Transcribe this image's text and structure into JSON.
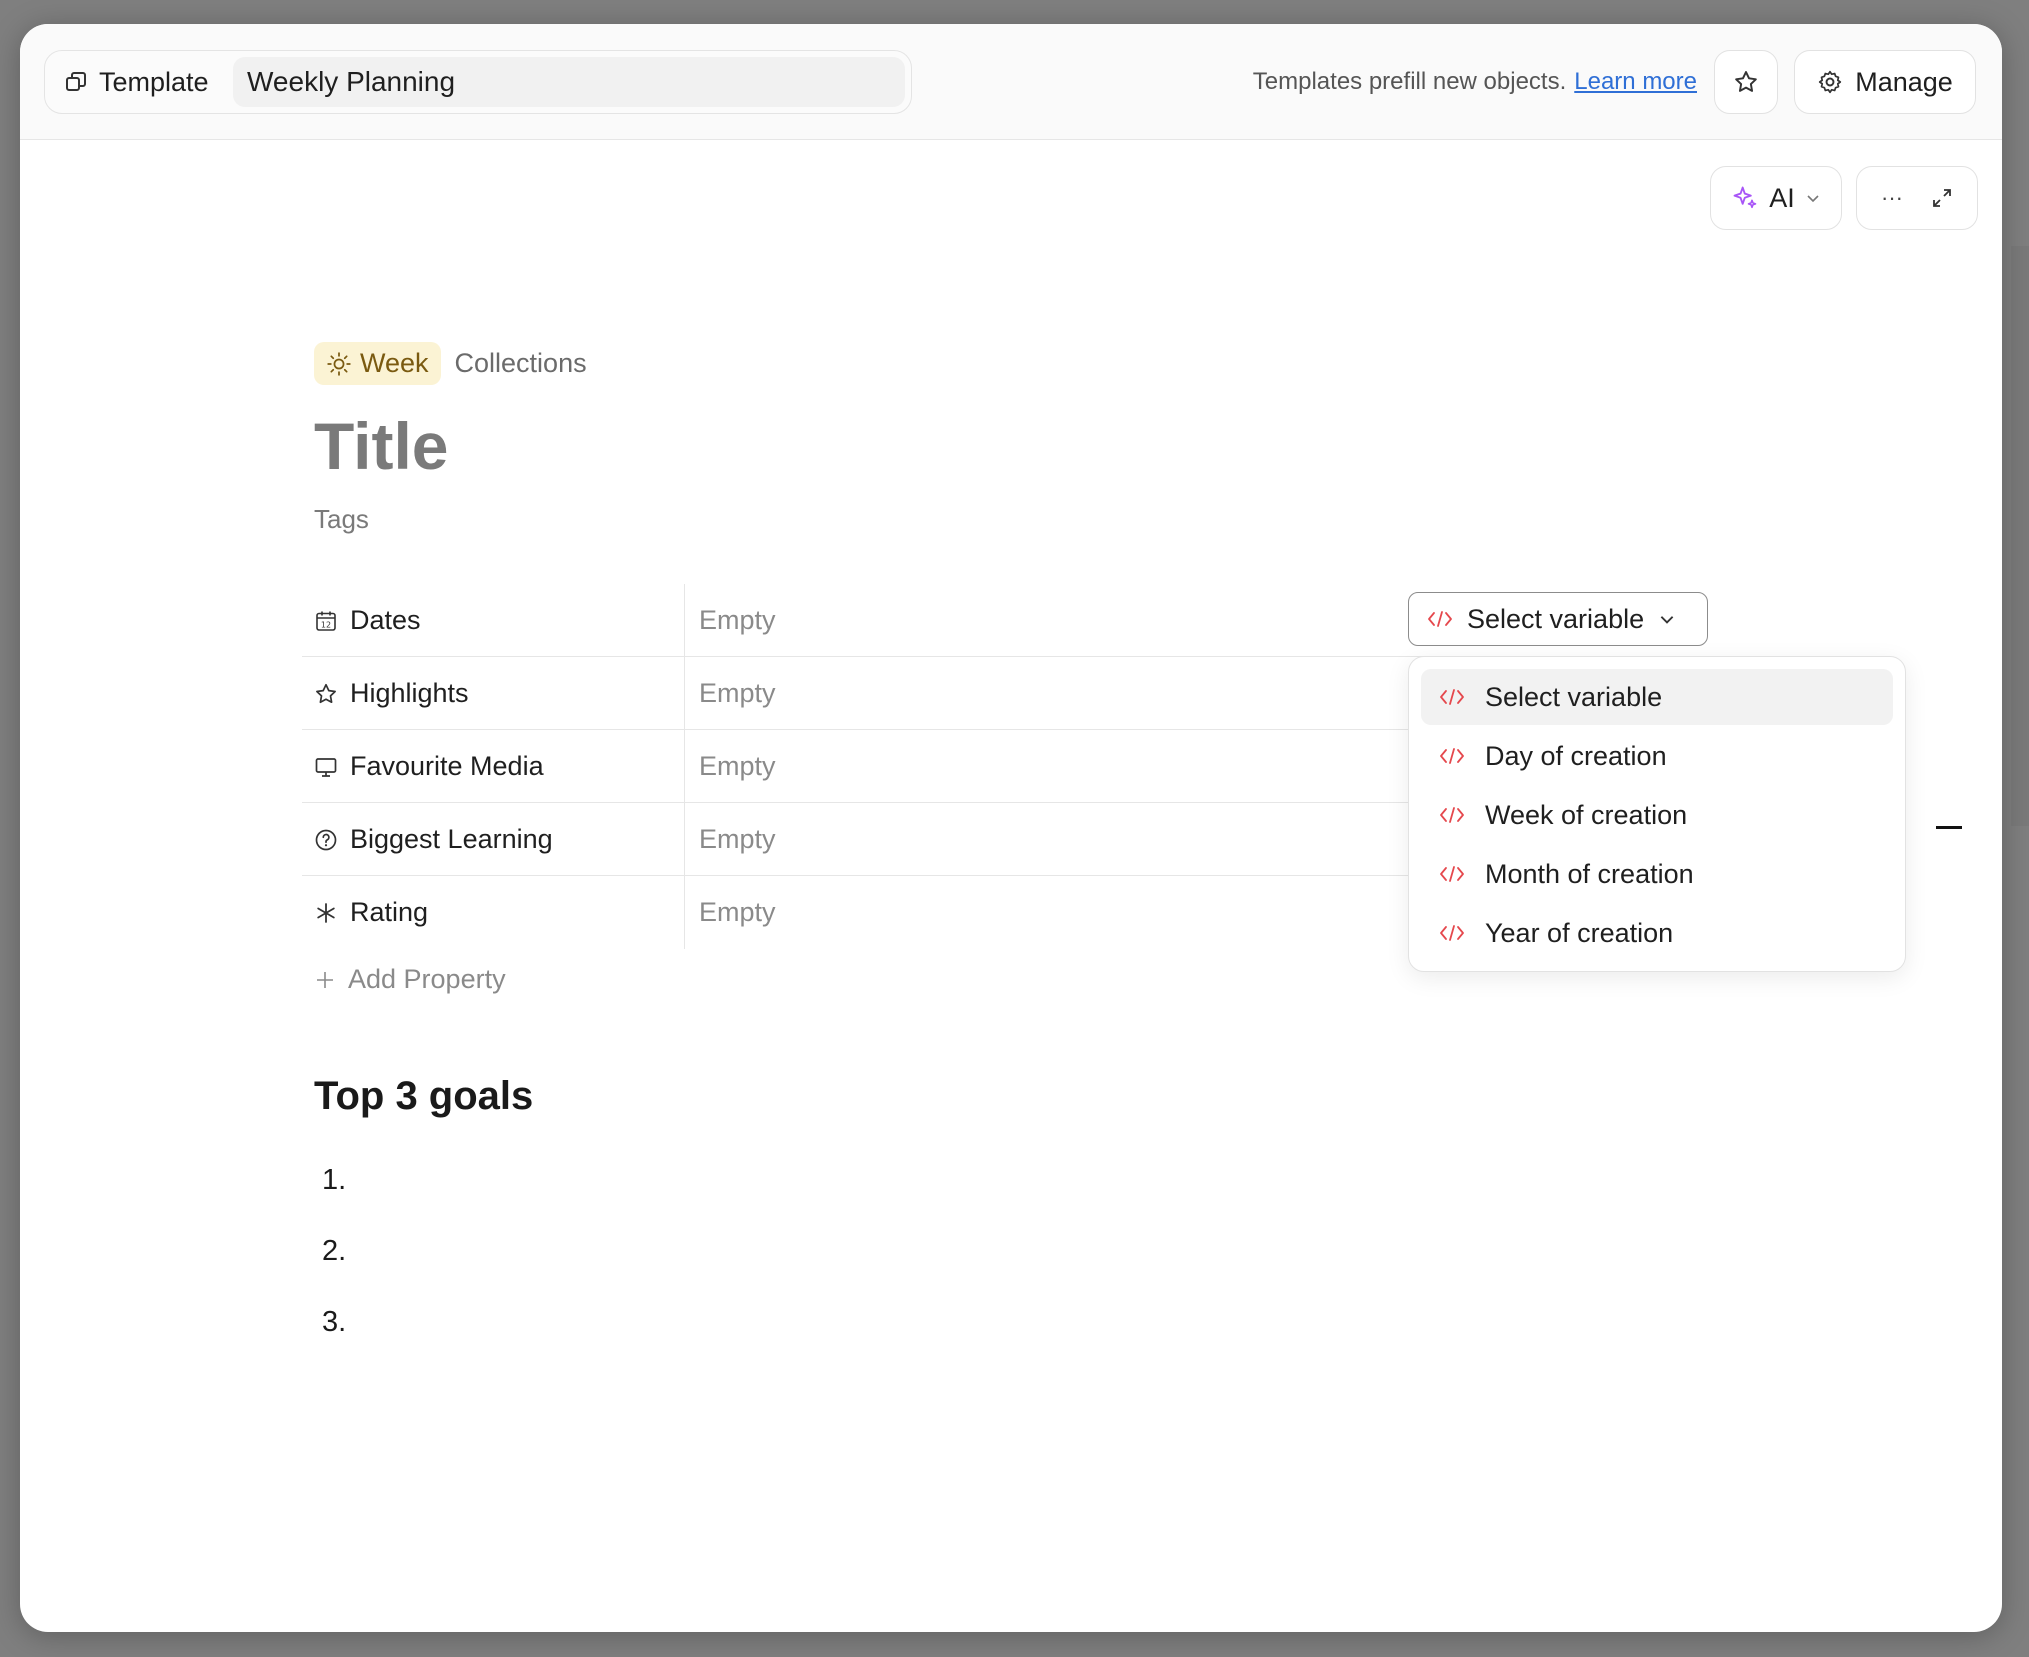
{
  "header": {
    "template_label": "Template",
    "template_name": "Weekly Planning",
    "hint_text": "Templates prefill new objects.",
    "hint_link": "Learn more",
    "manage_label": "Manage"
  },
  "toolbar": {
    "ai_label": "AI",
    "more_label": "···"
  },
  "object": {
    "type_label": "Week",
    "collection_label": "Collections",
    "title_placeholder": "Title",
    "tags_label": "Tags"
  },
  "properties": [
    {
      "name": "Dates",
      "value": "Empty",
      "icon": "calendar-icon"
    },
    {
      "name": "Highlights",
      "value": "Empty",
      "icon": "star-icon"
    },
    {
      "name": "Favourite Media",
      "value": "Empty",
      "icon": "monitor-icon"
    },
    {
      "name": "Biggest Learning",
      "value": "Empty",
      "icon": "question-circle-icon"
    },
    {
      "name": "Rating",
      "value": "Empty",
      "icon": "asterisk-icon"
    }
  ],
  "add_property_label": "Add Property",
  "variable_select": {
    "selected": "Select variable",
    "options": [
      "Select variable",
      "Day of creation",
      "Week of creation",
      "Month of creation",
      "Year of creation"
    ]
  },
  "body": {
    "heading": "Top 3 goals",
    "list_numbers": [
      "1.",
      "2.",
      "3."
    ]
  },
  "colors": {
    "accent_link": "#2f6fd6",
    "variable_icon": "#e5484d",
    "ai_icon": "#a855f7",
    "week_pill_bg": "#fbf3d4"
  }
}
